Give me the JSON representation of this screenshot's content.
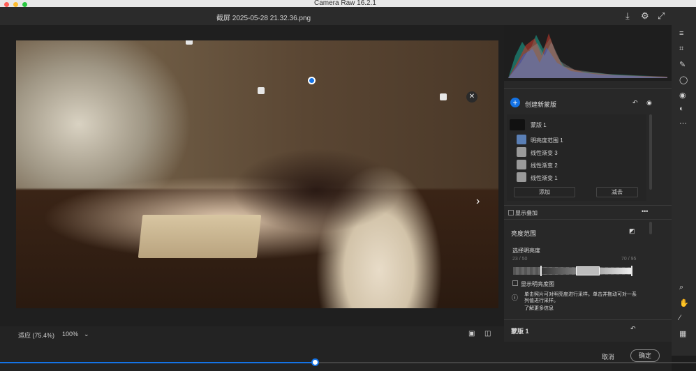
{
  "window": {
    "app_title": "Camera Raw 16.2.1",
    "traffic_colors": [
      "#ff5f57",
      "#febc2e",
      "#28c840"
    ]
  },
  "header": {
    "filename": "截屏 2025-05-28 21.32.36.png"
  },
  "canvas": {
    "zoom_fit": "适应 (75.4%)",
    "zoom_100": "100%"
  },
  "mask_panel": {
    "create_new_mask": "创建新蒙版",
    "masks": [
      {
        "label": "蒙版 1"
      },
      {
        "label": "明亮度范围 1"
      },
      {
        "label": "线性渐变 3"
      },
      {
        "label": "线性渐变 2"
      },
      {
        "label": "线性渐变 1"
      }
    ],
    "add_button": "添加",
    "subtract_button": "减去",
    "show_overlay": "显示叠加"
  },
  "luminance_range": {
    "title": "亮度范围",
    "select_label": "选择明亮度",
    "range_low": "23 / 50",
    "range_high": "70 / 95",
    "show_luminance_map": "显示明亮度图",
    "info_text": "单击照片可对明亮度进行采样。单击并拖动可对一系列值进行采样。",
    "learn_more": "了解更多信息"
  },
  "mask_settings": {
    "title": "蒙版 1"
  },
  "footer": {
    "cancel": "取消",
    "ok": "确定"
  },
  "colors": {
    "accent": "#1473e6",
    "panel_bg": "#282828"
  }
}
